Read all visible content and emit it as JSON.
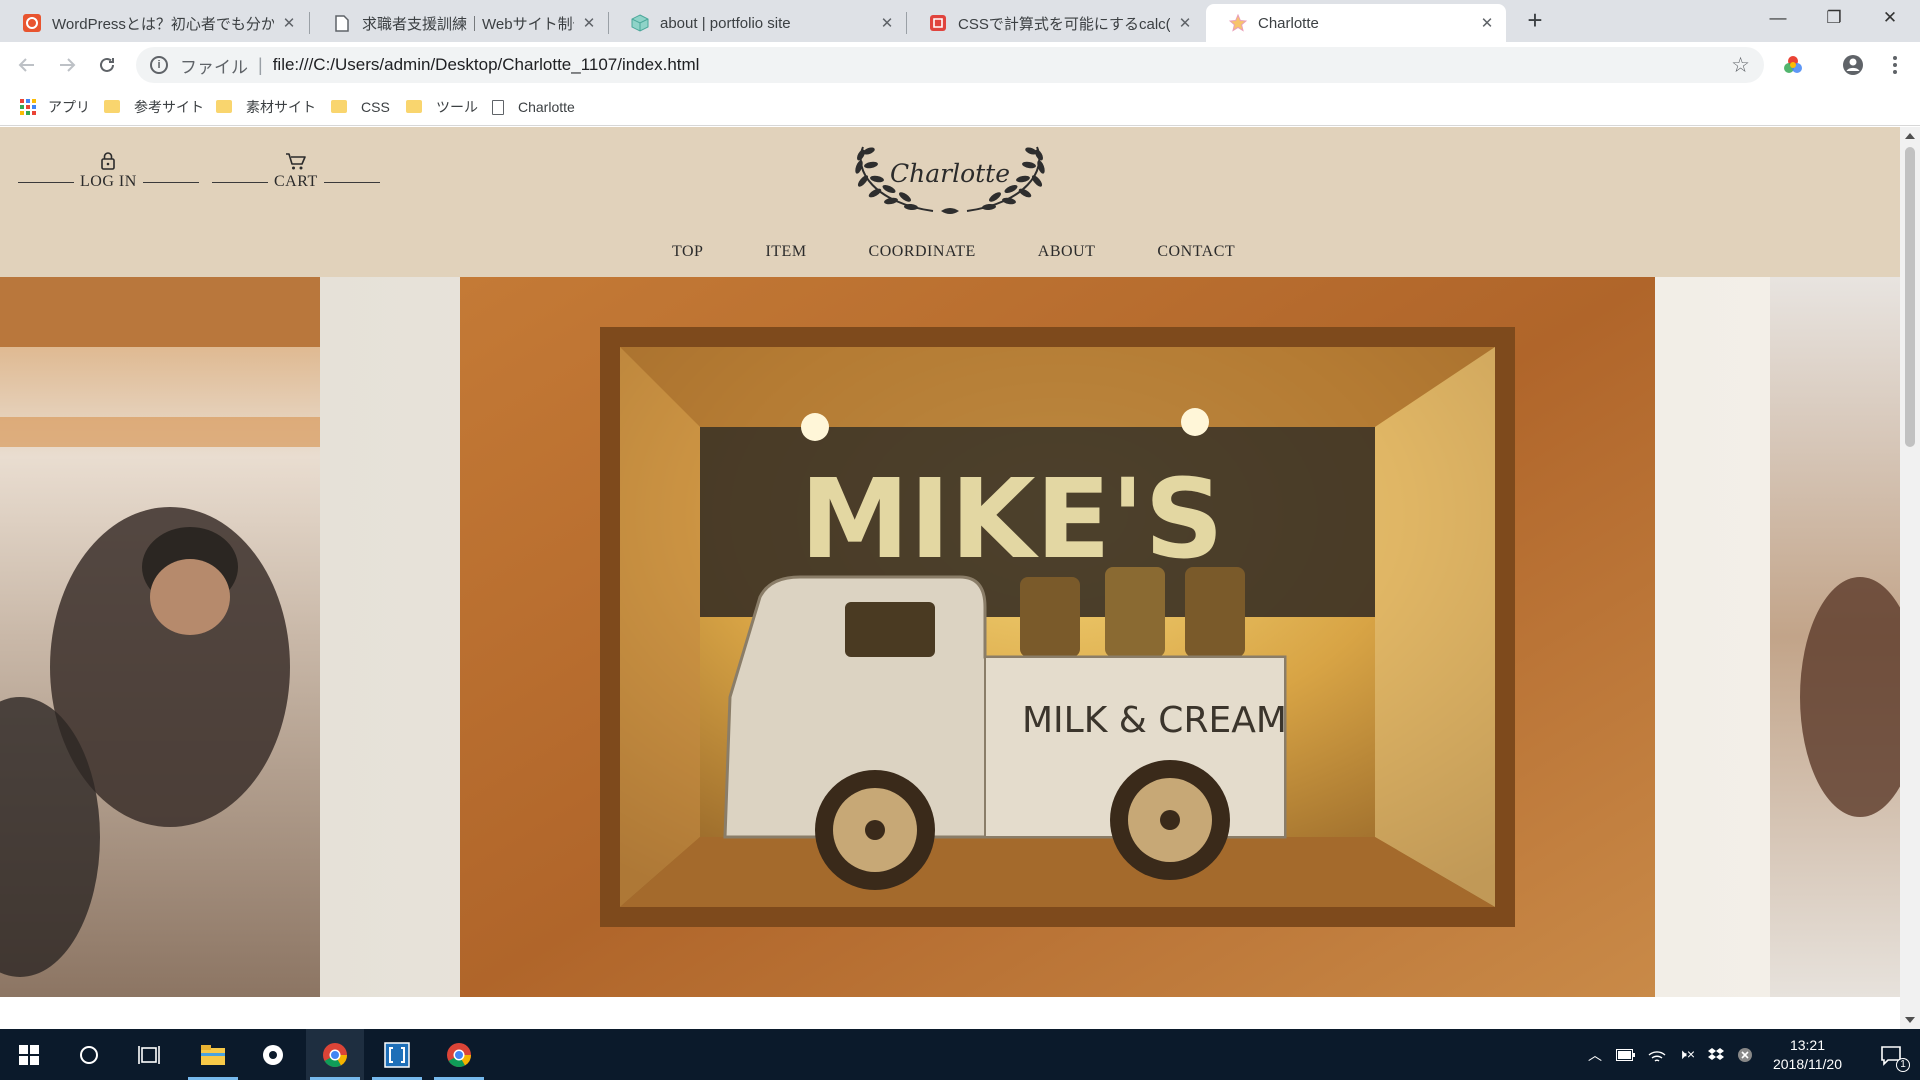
{
  "browser": {
    "tabs": [
      {
        "title": "WordPressとは？初心者でも分かる",
        "icon": "wordpress-icon",
        "active": false
      },
      {
        "title": "求職者支援訓練｜Webサイト制作",
        "icon": "document-icon",
        "active": false
      },
      {
        "title": "about | portfolio site",
        "icon": "cube-icon",
        "active": false
      },
      {
        "title": "CSSで計算式を可能にするcalc()ファ",
        "icon": "red-shield-icon",
        "active": false
      },
      {
        "title": "Charlotte",
        "icon": "star-icon",
        "active": true
      }
    ],
    "new_tab": "+",
    "window_controls": {
      "minimize": "—",
      "restore": "❐",
      "close": "✕"
    },
    "address": {
      "scheme_label": "ファイル",
      "url": "file:///C:/Users/admin/Desktop/Charlotte_1107/index.html"
    },
    "bookmarks": [
      {
        "label": "アプリ",
        "icon": "apps-grid-icon"
      },
      {
        "label": "参考サイト",
        "icon": "folder-icon"
      },
      {
        "label": "素材サイト",
        "icon": "folder-icon"
      },
      {
        "label": "CSS",
        "icon": "folder-icon"
      },
      {
        "label": "ツール",
        "icon": "folder-icon"
      },
      {
        "label": "Charlotte",
        "icon": "page-icon"
      }
    ]
  },
  "site": {
    "account": {
      "login": "LOG IN",
      "cart": "CART"
    },
    "logo_text": "Charlotte",
    "nav": [
      "TOP",
      "ITEM",
      "COORDINATE",
      "ABOUT",
      "CONTACT"
    ],
    "hero": {
      "truck_text": "MILK & CREAM",
      "sign_text": "MIKE'S"
    },
    "colors": {
      "header_bg": "#e1d2bb",
      "text": "#2b2b2b",
      "frame_wood": "#b86a2a"
    }
  },
  "taskbar": {
    "time": "13:21",
    "date": "2018/11/20",
    "notification_count": "1"
  }
}
